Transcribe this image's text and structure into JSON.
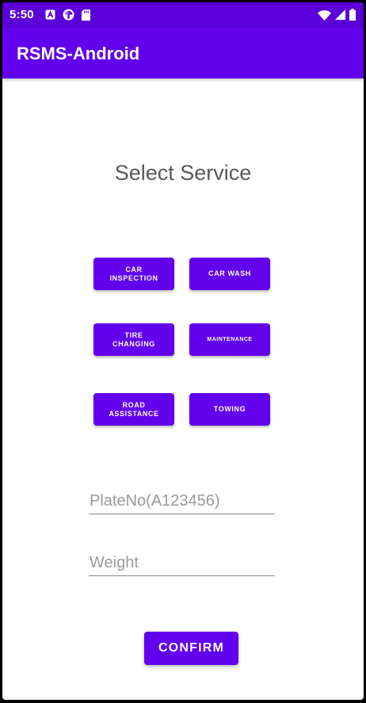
{
  "status_bar": {
    "time": "5:50",
    "color": "#5b00d9",
    "left_icons": [
      "text-notification-icon",
      "pinwheel-icon",
      "sd-card-icon"
    ],
    "right_icons": [
      "wifi-icon",
      "cellular-signal-icon",
      "battery-icon"
    ]
  },
  "app_bar": {
    "title": "RSMS-Android",
    "color": "#6200ee"
  },
  "main": {
    "title": "Select Service",
    "services": [
      {
        "label": "CAR\nINSPECTION"
      },
      {
        "label": "CAR WASH"
      },
      {
        "label": "TIRE\nCHANGING"
      },
      {
        "label": "MAINTENANCE"
      },
      {
        "label": "ROAD\nASSISTANCE"
      },
      {
        "label": "TOWING"
      }
    ],
    "plate_field": {
      "value": "",
      "placeholder": "PlateNo(A123456)"
    },
    "weight_field": {
      "value": "",
      "placeholder": "Weight"
    },
    "confirm_label": "CONFIRM"
  }
}
